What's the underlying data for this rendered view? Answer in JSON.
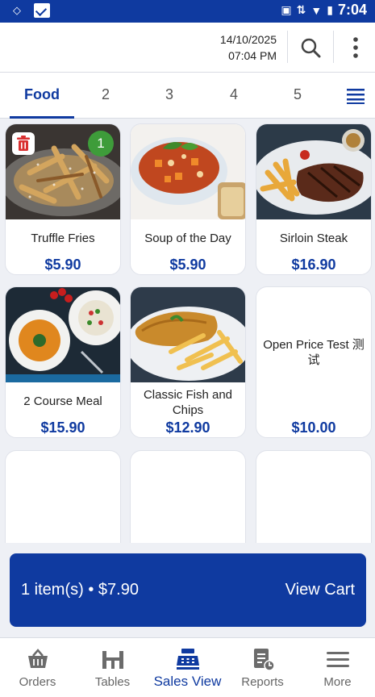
{
  "status_bar": {
    "time": "7:04"
  },
  "header": {
    "date": "14/10/2025",
    "time": "07:04 PM"
  },
  "tabs": [
    {
      "label": "Food",
      "active": true
    },
    {
      "label": "2",
      "active": false
    },
    {
      "label": "3",
      "active": false
    },
    {
      "label": "4",
      "active": false
    },
    {
      "label": "5",
      "active": false
    }
  ],
  "products": [
    {
      "name": "Truffle Fries",
      "price": "$5.90",
      "image": "fries",
      "qty_badge": "1"
    },
    {
      "name": "Soup of the Day",
      "price": "$5.90",
      "image": "soup"
    },
    {
      "name": "Sirloin Steak",
      "price": "$16.90",
      "image": "steak"
    },
    {
      "name": "2 Course Meal",
      "price": "$15.90",
      "image": "meal"
    },
    {
      "name": "Classic Fish and Chips",
      "price": "$12.90",
      "image": "fishchips"
    },
    {
      "name": "Open Price Test 测试",
      "price": "$10.00",
      "image": "none"
    }
  ],
  "cart": {
    "summary": "1 item(s) • $7.90",
    "action": "View Cart"
  },
  "bottom_nav": [
    {
      "label": "Orders",
      "icon": "basket-icon"
    },
    {
      "label": "Tables",
      "icon": "tables-icon"
    },
    {
      "label": "Sales View",
      "icon": "register-icon",
      "active": true
    },
    {
      "label": "Reports",
      "icon": "report-icon"
    },
    {
      "label": "More",
      "icon": "hamburger-icon"
    }
  ],
  "colors": {
    "primary": "#0f3aa0",
    "badge": "#3e9c3a",
    "trash": "#d93030"
  }
}
